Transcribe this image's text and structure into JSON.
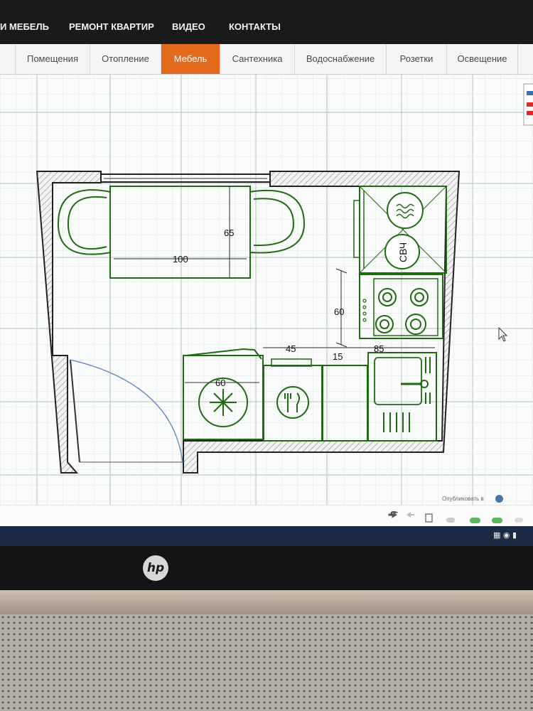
{
  "topnav": {
    "items": [
      "И МЕБЕЛЬ",
      "РЕМОНТ КВАРТИР",
      "ВИДЕО",
      "КОНТАКТЫ"
    ]
  },
  "tabs": [
    {
      "label": "Помещения",
      "active": false
    },
    {
      "label": "Отопление",
      "active": false
    },
    {
      "label": "Мебель",
      "active": true
    },
    {
      "label": "Сантехника",
      "active": false
    },
    {
      "label": "Водоснабжение",
      "active": false
    },
    {
      "label": "Розетки",
      "active": false
    },
    {
      "label": "Освещение",
      "active": false
    }
  ],
  "plan": {
    "dimensions": {
      "table_depth": "65",
      "table_width": "100",
      "fridge_width": "60",
      "gap_45": "45",
      "gap_15": "15",
      "sink_85": "85",
      "hob_60": "60"
    },
    "microwave_label": "СВЧ"
  },
  "bottombar": {
    "publish_label": "Опубликовать в"
  },
  "colors": {
    "accent": "#e46a1b",
    "furniture": "#1f6b12",
    "dimension": "#2b2b2b",
    "wall_hatch": "#7a7a7a"
  },
  "laptop": {
    "brand": "hp"
  }
}
